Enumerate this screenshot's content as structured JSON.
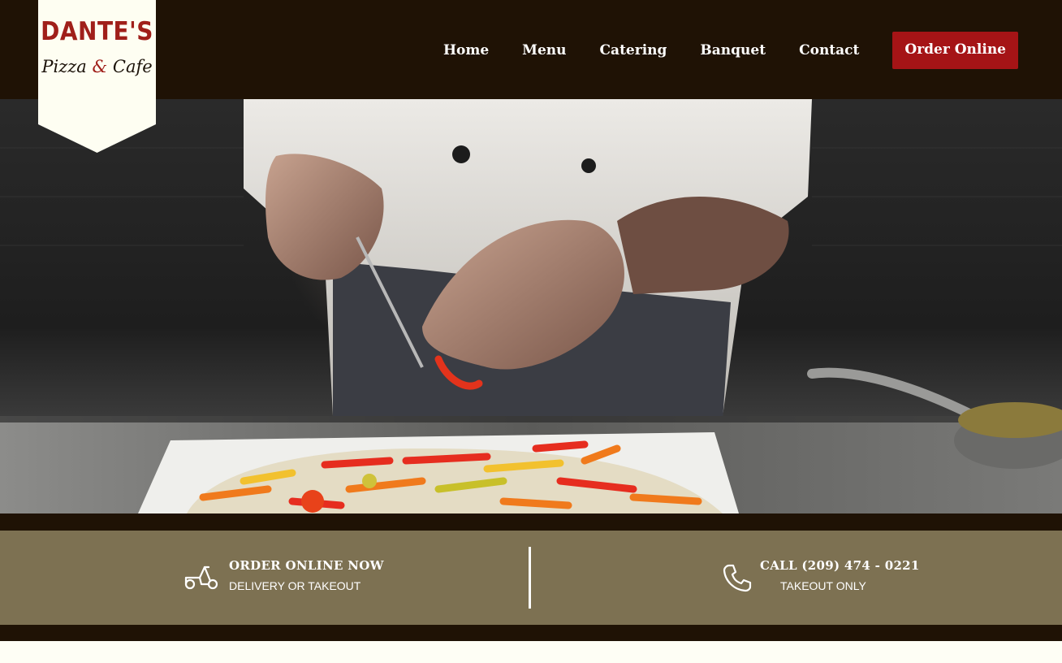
{
  "brand": {
    "name": "DANTE'S",
    "tagline_left": "Pizza",
    "tagline_amp": "&",
    "tagline_right": "Cafe"
  },
  "nav": {
    "items": [
      "Home",
      "Menu",
      "Catering",
      "Banquet",
      "Contact"
    ],
    "order_label": "Order Online"
  },
  "hero": {
    "scene": "chef-arranging-peppers-on-pizza"
  },
  "info_band": {
    "order": {
      "title": "ORDER ONLINE NOW",
      "subtitle": "DELIVERY OR TAKEOUT",
      "icon": "scooter-icon"
    },
    "call": {
      "title": "CALL (209) 474 - 0221",
      "subtitle": "TAKEOUT ONLY",
      "icon": "phone-icon"
    }
  },
  "colors": {
    "header_bg": "#1f1205",
    "accent_red": "#a51416",
    "band_bg": "#7d7152",
    "page_bg": "#fefef5"
  }
}
